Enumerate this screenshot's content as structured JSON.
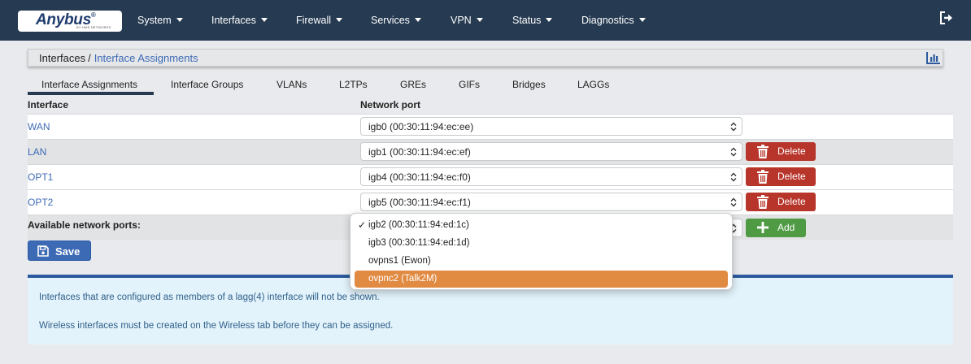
{
  "brand": {
    "logo_text": "Anybus",
    "logo_sub": "BY HMS NETWORKS"
  },
  "nav": {
    "items": [
      {
        "label": "System"
      },
      {
        "label": "Interfaces"
      },
      {
        "label": "Firewall"
      },
      {
        "label": "Services"
      },
      {
        "label": "VPN"
      },
      {
        "label": "Status"
      },
      {
        "label": "Diagnostics"
      }
    ],
    "logout_icon": "logout-icon"
  },
  "breadcrumb": {
    "parent": "Interfaces",
    "separator": "/",
    "current": "Interface Assignments",
    "action_icon": "bar-chart-icon"
  },
  "tabs": [
    {
      "label": "Interface Assignments",
      "active": true
    },
    {
      "label": "Interface Groups"
    },
    {
      "label": "VLANs"
    },
    {
      "label": "L2TPs"
    },
    {
      "label": "GREs"
    },
    {
      "label": "GIFs"
    },
    {
      "label": "Bridges"
    },
    {
      "label": "LAGGs"
    }
  ],
  "table": {
    "headers": {
      "interface": "Interface",
      "network_port": "Network port"
    },
    "rows": [
      {
        "interface": "WAN",
        "port": "igb0 (00:30:11:94:ec:ee)",
        "delete": false
      },
      {
        "interface": "LAN",
        "port": "igb1 (00:30:11:94:ec:ef)",
        "delete": true
      },
      {
        "interface": "OPT1",
        "port": "igb4 (00:30:11:94:ec:f0)",
        "delete": true
      },
      {
        "interface": "OPT2",
        "port": "igb5 (00:30:11:94:ec:f1)",
        "delete": true
      }
    ],
    "delete_label": "Delete",
    "available_label": "Available network ports:",
    "add_label": "Add"
  },
  "dropdown": {
    "options": [
      {
        "label": "igb2 (00:30:11:94:ed:1c)",
        "checked": true
      },
      {
        "label": "igb3 (00:30:11:94:ed:1d)"
      },
      {
        "label": "ovpns1 (Ewon)"
      },
      {
        "label": "ovpnc2 (Talk2M)",
        "highlighted": true
      }
    ],
    "check_mark": "✓"
  },
  "save_label": "Save",
  "info": {
    "lines": [
      "Interfaces that are configured as members of a lagg(4) interface will not be shown.",
      "Wireless interfaces must be created on the Wireless tab before they can be assigned."
    ]
  },
  "colors": {
    "navbar": "#263a52",
    "link": "#3d6ab5",
    "delete": "#b7352b",
    "add": "#4f9b44",
    "save": "#3d6ab5",
    "highlight": "#e08a42",
    "info_bg": "#e3f3fb",
    "info_border": "#2d5a9e"
  }
}
